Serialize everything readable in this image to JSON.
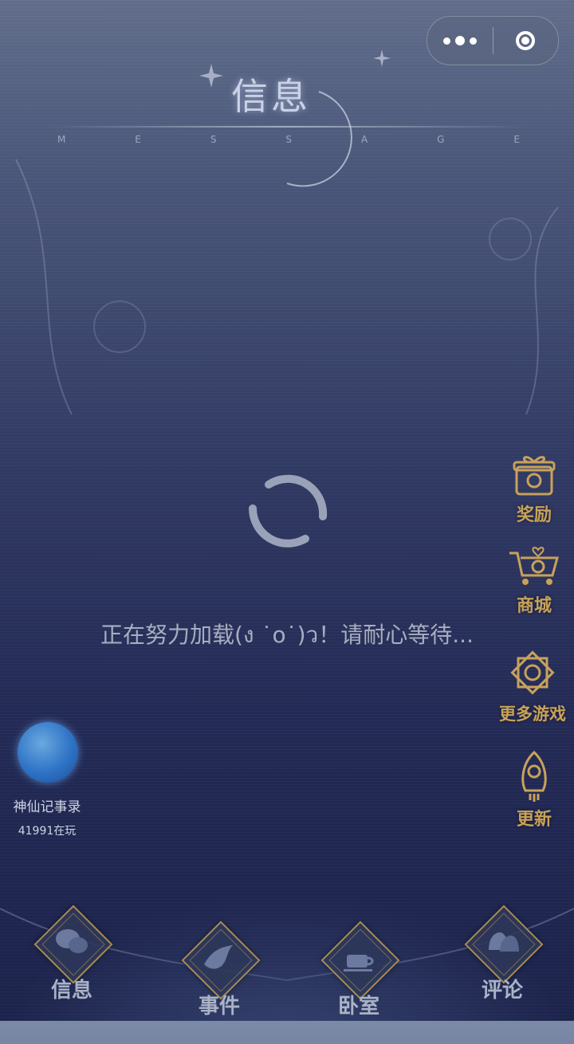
{
  "header": {
    "title": "信息",
    "subtitle_letters": [
      "M",
      "E",
      "S",
      "S",
      "A",
      "G",
      "E"
    ]
  },
  "capsule": {
    "more_icon": "more-dots-icon",
    "close_icon": "target-close-icon"
  },
  "loading": {
    "text": "正在努力加载(ง ˙o˙)ว！请耐心等待..."
  },
  "side_menu": [
    {
      "label": "奖励",
      "icon": "gift-box-icon"
    },
    {
      "label": "商城",
      "icon": "shopping-cart-icon"
    },
    {
      "label": "更多游戏",
      "icon": "star-badge-icon"
    },
    {
      "label": "更新",
      "icon": "rocket-icon"
    }
  ],
  "mini_app": {
    "name": "神仙记事录",
    "players": "41991在玩"
  },
  "bottom_nav": [
    {
      "label": "信息",
      "icon": "chat-bubbles-icon"
    },
    {
      "label": "事件",
      "icon": "dove-icon"
    },
    {
      "label": "卧室",
      "icon": "coffee-cup-icon"
    },
    {
      "label": "评论",
      "icon": "bells-icon"
    }
  ],
  "colors": {
    "accent_gold": "#c8a25a",
    "background_top": "#7b8aa7",
    "background_bottom": "#1f2752"
  }
}
